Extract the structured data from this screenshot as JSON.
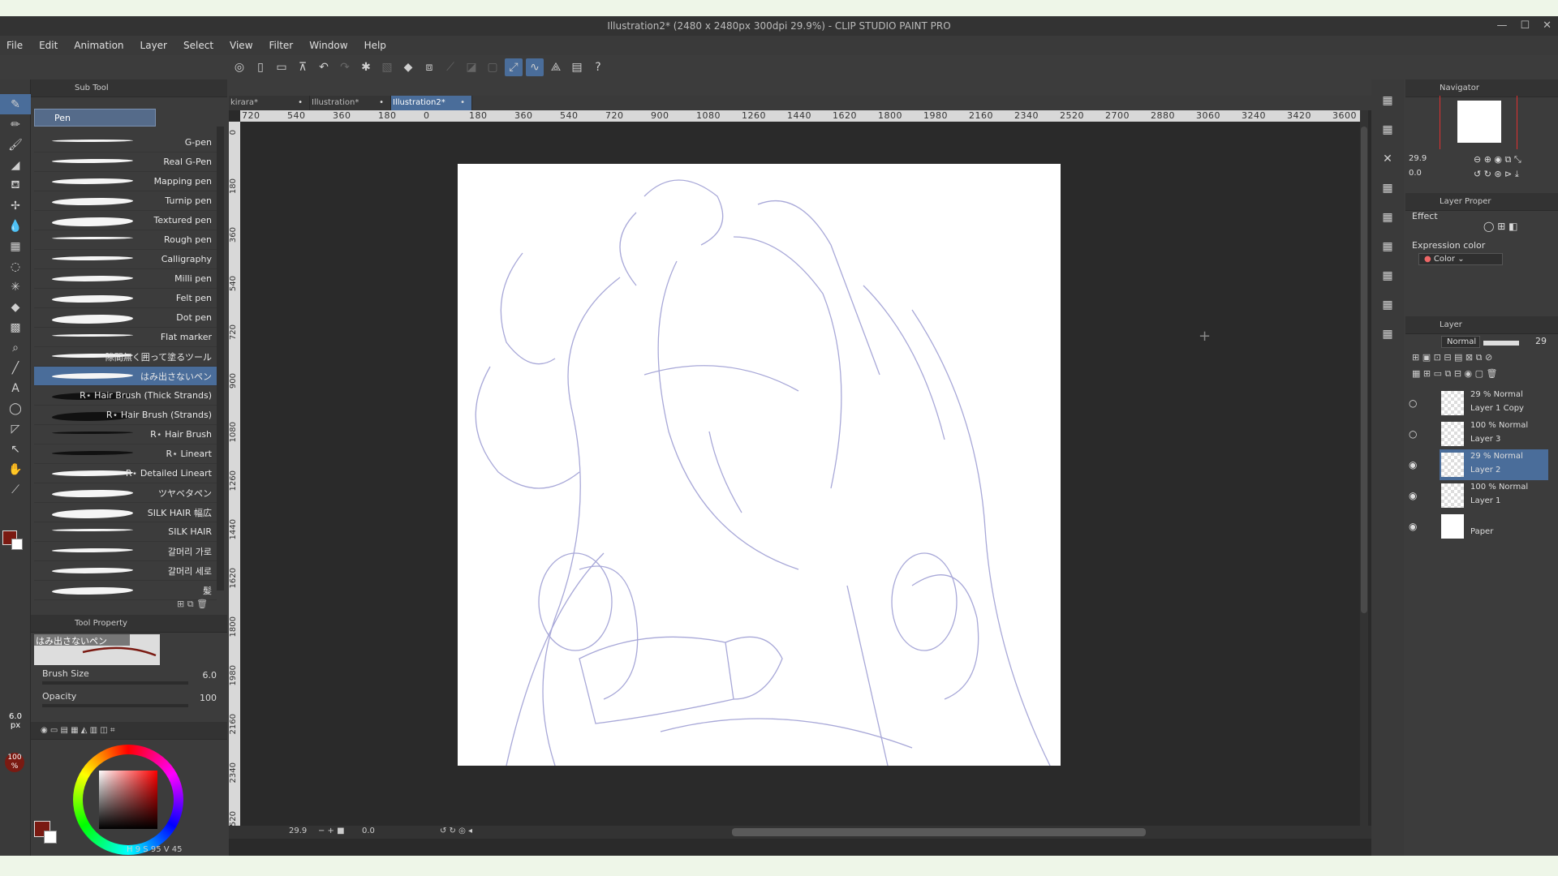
{
  "window": {
    "title": "Illustration2* (2480 x 2480px 300dpi 29.9%) - CLIP STUDIO PAINT PRO",
    "controls": [
      "—",
      "☐",
      "✕"
    ]
  },
  "menu": [
    "File",
    "Edit",
    "Animation",
    "Layer",
    "Select",
    "View",
    "Filter",
    "Window",
    "Help"
  ],
  "subtool_panel": {
    "title": "Sub Tool",
    "group": "Pen",
    "brushes": [
      "G-pen",
      "Real G-Pen",
      "Mapping pen",
      "Turnip pen",
      "Textured pen",
      "Rough pen",
      "Calligraphy",
      "Milli pen",
      "Felt pen",
      "Dot pen",
      "Flat marker",
      "隙間無く囲って塗るツール",
      "はみ出さないペン",
      "R⋆ Hair Brush (Thick Strands)",
      "R⋆ Hair Brush (Strands)",
      "R⋆ Hair Brush",
      "R⋆ Lineart",
      "R⋆ Detailed Lineart",
      "ツヤベタペン",
      "SILK HAIR 幅広",
      "SILK HAIR",
      "갈머리 가로",
      "갈머리 세로",
      "髪"
    ],
    "selected_index": 12
  },
  "tool_property": {
    "title": "Tool Property",
    "tool_name": "はみ出さないペン",
    "brush_size_label": "Brush Size",
    "brush_size_value": "6.0",
    "opacity_label": "Opacity",
    "opacity_value": "100"
  },
  "left_indicators": {
    "size": "6.0",
    "size_unit": "px",
    "opacity": "100",
    "opacity_unit": "%"
  },
  "color": {
    "main": "#7a1a12",
    "sub": "#ffffff",
    "values_h": "9",
    "values_s": "95",
    "values_v": "45",
    "h_label": "H",
    "s_label": "S",
    "v_label": "V"
  },
  "doc_tabs": [
    "kirara*",
    "Illustration*",
    "Illustration2*"
  ],
  "active_tab": 2,
  "ruler": {
    "h_labels": [
      "720",
      "540",
      "360",
      "180",
      "0",
      "180",
      "360",
      "540",
      "720",
      "900",
      "1080",
      "1260",
      "1440",
      "1620",
      "1800",
      "1980",
      "2160",
      "2340",
      "2520",
      "2700",
      "2880",
      "3060",
      "3240",
      "3420",
      "3600"
    ],
    "v_labels": [
      "0",
      "180",
      "360",
      "540",
      "720",
      "900",
      "1080",
      "1260",
      "1440",
      "1620",
      "1800",
      "1980",
      "2160",
      "2340",
      "2520"
    ]
  },
  "canvas_status": {
    "zoom": "29.9",
    "angle": "0.0"
  },
  "navigator": {
    "title": "Navigator",
    "zoom": "29.9",
    "angle": "0.0"
  },
  "layer_property": {
    "title": "Layer Proper",
    "effect_label": "Effect",
    "expression_color_label": "Expression color",
    "expression_color_value": "Color"
  },
  "layer_panel": {
    "title": "Layer",
    "blend_mode": "Normal",
    "opacity": "29",
    "layers": [
      {
        "blend": "29 % Normal",
        "name": "Layer 1 Copy",
        "visible": false,
        "selected": false
      },
      {
        "blend": "100 % Normal",
        "name": "Layer 3",
        "visible": false,
        "selected": false
      },
      {
        "blend": "29 % Normal",
        "name": "Layer 2",
        "visible": true,
        "selected": true
      },
      {
        "blend": "100 % Normal",
        "name": "Layer 1",
        "visible": true,
        "selected": false
      },
      {
        "blend": "",
        "name": "Paper",
        "visible": true,
        "selected": false
      }
    ]
  },
  "sketch_color": "#a8a8d8"
}
